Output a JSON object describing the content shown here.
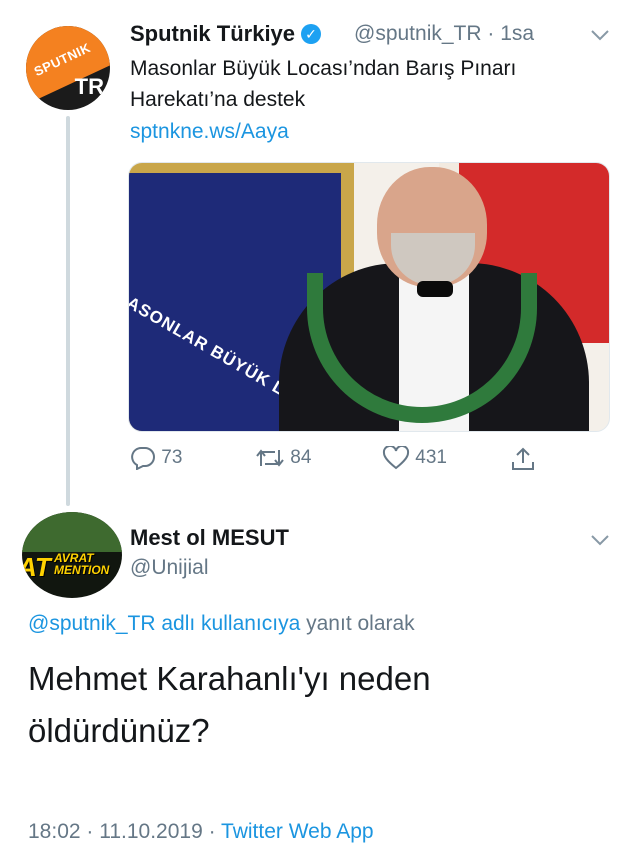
{
  "tweet": {
    "author_name": "Sputnik Türkiye",
    "handle": "@sputnik_TR",
    "time": "· 1sa",
    "text_line1": "Masonlar Büyük Locası’ndan Barış Pınarı",
    "text_line2": "Harekatı’na destek",
    "link": "sptnkne.ws/Aaya",
    "avatar_brand": "SPUTNIK",
    "avatar_tr": "TR",
    "media_banner_text": "ASONLAR BÜYÜK LO",
    "counts": {
      "replies": "73",
      "retweets": "84",
      "likes": "431"
    }
  },
  "reply": {
    "author_name": "Mest ol MESUT",
    "handle": "@Unijial",
    "avatar_text_main": "AT",
    "avatar_text_top": "AVRAT",
    "avatar_text_bottom": "MENTION",
    "replying_mention": "@sputnik_TR adlı kullanıcıya",
    "replying_suffix": "yanıt olarak",
    "text_line1": "Mehmet Karahanlı'yı neden",
    "text_line2": "öldürdünüz?",
    "time": "18:02 · 11.10.2019 · ",
    "app": "Twitter Web App"
  },
  "colors": {
    "link": "#1b95e0",
    "muted": "#657786",
    "verified": "#1da1f2"
  },
  "icons": [
    "verified-icon",
    "chevron-down-icon",
    "reply-icon",
    "retweet-icon",
    "like-icon",
    "share-icon"
  ]
}
